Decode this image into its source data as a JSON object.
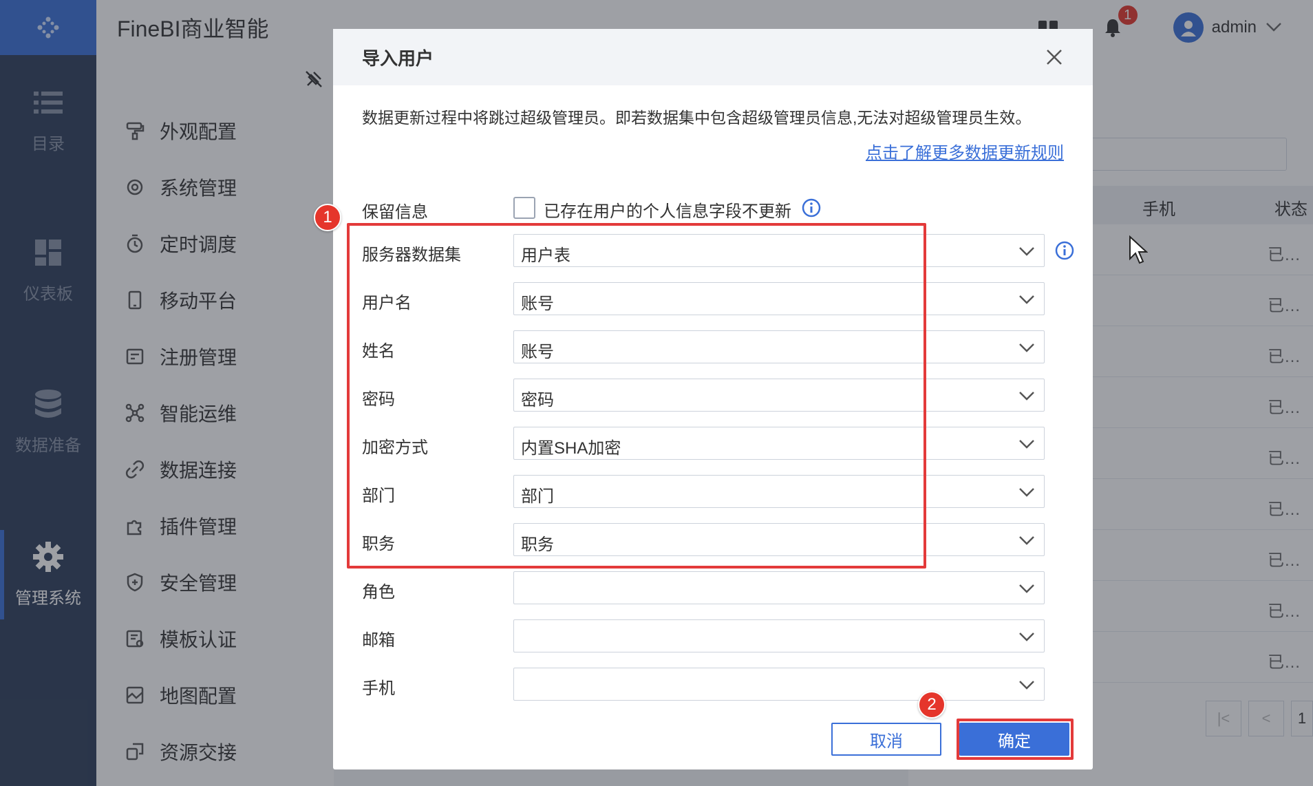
{
  "app": {
    "title": "FineBI商业智能"
  },
  "header": {
    "notification_count": "1",
    "user": "admin"
  },
  "rail": {
    "items": [
      {
        "label": "目录",
        "icon": "list-icon"
      },
      {
        "label": "仪表板",
        "icon": "dashboard-icon"
      },
      {
        "label": "数据准备",
        "icon": "database-icon"
      },
      {
        "label": "管理系统",
        "icon": "gear-icon",
        "active": true
      }
    ]
  },
  "menu": {
    "items": [
      {
        "label": "外观配置",
        "icon": "brush-icon"
      },
      {
        "label": "系统管理",
        "icon": "settings-icon"
      },
      {
        "label": "定时调度",
        "icon": "timer-icon"
      },
      {
        "label": "移动平台",
        "icon": "mobile-icon"
      },
      {
        "label": "注册管理",
        "icon": "register-icon"
      },
      {
        "label": "智能运维",
        "icon": "network-icon"
      },
      {
        "label": "数据连接",
        "icon": "link-icon"
      },
      {
        "label": "插件管理",
        "icon": "plugin-icon"
      },
      {
        "label": "安全管理",
        "icon": "shield-icon"
      },
      {
        "label": "模板认证",
        "icon": "certificate-icon"
      },
      {
        "label": "地图配置",
        "icon": "map-icon"
      },
      {
        "label": "资源交接",
        "icon": "transfer-icon"
      }
    ]
  },
  "background_table": {
    "headers": {
      "phone": "手机",
      "status": "状态"
    },
    "rows": [
      "已…",
      "已…",
      "已…",
      "已…",
      "已…",
      "已…",
      "已…",
      "已…",
      "已…"
    ],
    "pager": {
      "first": "|<",
      "prev": "<",
      "page": "1"
    }
  },
  "dialog": {
    "title": "导入用户",
    "notice": "数据更新过程中将跳过超级管理员。即若数据集中包含超级管理员信息,无法对超级管理员生效。",
    "rule_link": "点击了解更多数据更新规则",
    "keep_info": {
      "label": "保留信息",
      "checkbox_label": "已存在用户的个人信息字段不更新",
      "checked": false
    },
    "fields": [
      {
        "label": "服务器数据集",
        "value": "用户表"
      },
      {
        "label": "用户名",
        "value": "账号"
      },
      {
        "label": "姓名",
        "value": "账号"
      },
      {
        "label": "密码",
        "value": "密码"
      },
      {
        "label": "加密方式",
        "value": "内置SHA加密"
      },
      {
        "label": "部门",
        "value": "部门"
      },
      {
        "label": "职务",
        "value": "职务"
      },
      {
        "label": "角色",
        "value": ""
      },
      {
        "label": "邮箱",
        "value": ""
      },
      {
        "label": "手机",
        "value": ""
      }
    ],
    "cancel_label": "取消",
    "ok_label": "确定"
  },
  "annotations": {
    "step1": "1",
    "step2": "2"
  },
  "colors": {
    "accent": "#3a6fd8",
    "annotation": "#e33a3a",
    "rail": "#2d3d59"
  }
}
